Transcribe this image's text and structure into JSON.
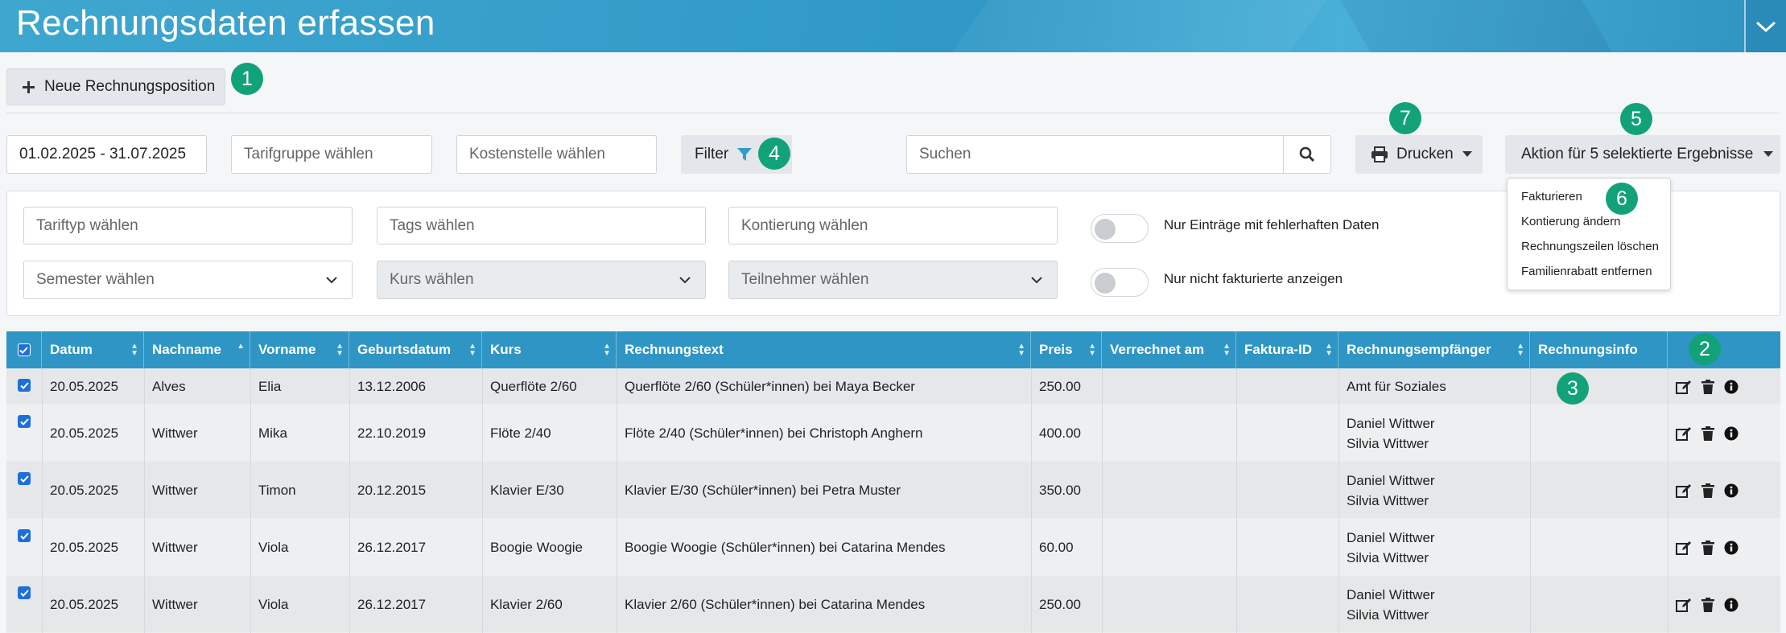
{
  "header": {
    "title": "Rechnungsdaten erfassen"
  },
  "toolbar": {
    "new_position_label": "Neue Rechnungsposition",
    "date_range": "01.02.2025 - 31.07.2025",
    "tarifgruppe_placeholder": "Tarifgruppe wählen",
    "kostenstelle_placeholder": "Kostenstelle wählen",
    "filter_label": "Filter",
    "search_placeholder": "Suchen",
    "print_label": "Drucken",
    "action_label": "Aktion für 5 selektierte Ergebnisse"
  },
  "badges": {
    "b1": "1",
    "b2": "2",
    "b3": "3",
    "b4": "4",
    "b5": "5",
    "b6": "6",
    "b7": "7"
  },
  "filters": {
    "tariftyp_placeholder": "Tariftyp wählen",
    "tags_placeholder": "Tags wählen",
    "kontierung_placeholder": "Kontierung wählen",
    "semester_placeholder": "Semester wählen",
    "kurs_placeholder": "Kurs wählen",
    "teilnehmer_placeholder": "Teilnehmer wählen",
    "toggle_errors_label": "Nur Einträge mit fehlerhaften Daten",
    "toggle_not_invoiced_label": "Nur nicht fakturierte anzeigen"
  },
  "action_menu": [
    "Fakturieren",
    "Kontierung ändern",
    "Rechnungszeilen löschen",
    "Familienrabatt entfernen"
  ],
  "table": {
    "columns": [
      "Datum",
      "Nachname",
      "Vorname",
      "Geburtsdatum",
      "Kurs",
      "Rechnungstext",
      "Preis",
      "Verrechnet am",
      "Faktura-ID",
      "Rechnungsempfänger",
      "Rechnungsinfo"
    ],
    "rows": [
      {
        "datum": "20.05.2025",
        "nachname": "Alves",
        "vorname": "Elia",
        "geburtsdatum": "13.12.2006",
        "kurs": "Querflöte 2/60",
        "text": "Querflöte 2/60 (Schüler*innen) bei Maya Becker",
        "preis": "250.00",
        "empfaenger1": "Amt für Soziales",
        "empfaenger2": ""
      },
      {
        "datum": "20.05.2025",
        "nachname": "Wittwer",
        "vorname": "Mika",
        "geburtsdatum": "22.10.2019",
        "kurs": "Flöte 2/40",
        "text": "Flöte 2/40 (Schüler*innen) bei Christoph Anghern",
        "preis": "400.00",
        "empfaenger1": "Daniel Wittwer",
        "empfaenger2": "Silvia Wittwer"
      },
      {
        "datum": "20.05.2025",
        "nachname": "Wittwer",
        "vorname": "Timon",
        "geburtsdatum": "20.12.2015",
        "kurs": "Klavier E/30",
        "text": "Klavier E/30 (Schüler*innen) bei Petra Muster",
        "preis": "350.00",
        "empfaenger1": "Daniel Wittwer",
        "empfaenger2": "Silvia Wittwer"
      },
      {
        "datum": "20.05.2025",
        "nachname": "Wittwer",
        "vorname": "Viola",
        "geburtsdatum": "26.12.2017",
        "kurs": "Boogie Woogie",
        "text": "Boogie Woogie (Schüler*innen) bei Catarina Mendes",
        "preis": "60.00",
        "empfaenger1": "Daniel Wittwer",
        "empfaenger2": "Silvia Wittwer"
      },
      {
        "datum": "20.05.2025",
        "nachname": "Wittwer",
        "vorname": "Viola",
        "geburtsdatum": "26.12.2017",
        "kurs": "Klavier 2/60",
        "text": "Klavier 2/60 (Schüler*innen) bei Catarina Mendes",
        "preis": "250.00",
        "empfaenger1": "Daniel Wittwer",
        "empfaenger2": "Silvia Wittwer"
      }
    ]
  },
  "colors": {
    "header": "#2f95c4",
    "badge": "#11a27a",
    "checkbox": "#1e6fd9"
  }
}
